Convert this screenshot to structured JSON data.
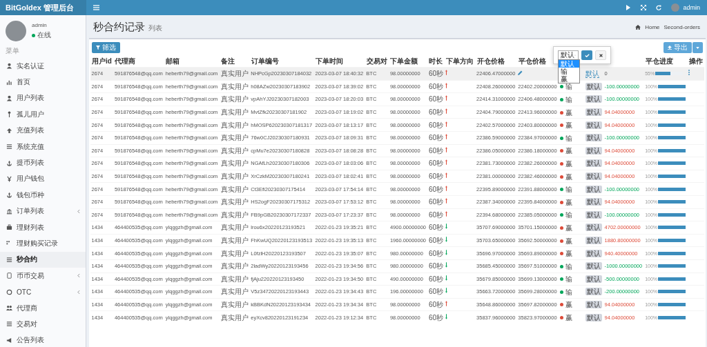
{
  "topbar": {
    "logo": "BitGoldex 管理后台",
    "user": "admin"
  },
  "sidebar": {
    "user": {
      "name": "admin",
      "status": "在线",
      "online": true
    },
    "menu_header": "菜单",
    "items": [
      {
        "label": "实名认证",
        "selected": false,
        "has_submenu": false
      },
      {
        "label": "首页",
        "selected": false,
        "has_submenu": false
      },
      {
        "label": "用户列表",
        "selected": false,
        "has_submenu": false
      },
      {
        "label": "孤儿用户",
        "selected": false,
        "has_submenu": false
      },
      {
        "label": "充值列表",
        "selected": false,
        "has_submenu": false
      },
      {
        "label": "系统充值",
        "selected": false,
        "has_submenu": false
      },
      {
        "label": "提币列表",
        "selected": false,
        "has_submenu": false
      },
      {
        "label": "用户钱包",
        "selected": false,
        "has_submenu": false
      },
      {
        "label": "钱包币种",
        "selected": false,
        "has_submenu": false
      },
      {
        "label": "订单列表",
        "selected": false,
        "has_submenu": true
      },
      {
        "label": "理财列表",
        "selected": false,
        "has_submenu": false
      },
      {
        "label": "理财购买记录",
        "selected": false,
        "has_submenu": false
      },
      {
        "label": "秒合约",
        "selected": true,
        "has_submenu": false
      },
      {
        "label": "币币交易",
        "selected": false,
        "has_submenu": true
      },
      {
        "label": "OTC",
        "selected": false,
        "has_submenu": true
      },
      {
        "label": "代理商",
        "selected": false,
        "has_submenu": false
      },
      {
        "label": "交易对",
        "selected": false,
        "has_submenu": false
      },
      {
        "label": "公告列表",
        "selected": false,
        "has_submenu": false
      }
    ]
  },
  "page": {
    "title": "秒合约记录",
    "subtitle": "列表",
    "breadcrumb": [
      "Home",
      "Second-orders"
    ]
  },
  "toolbar": {
    "filter_button": "筛选",
    "export_button": "导出"
  },
  "table": {
    "columns": [
      {
        "label": "用户id"
      },
      {
        "label": "代理商"
      },
      {
        "label": "邮箱"
      },
      {
        "label": "备注"
      },
      {
        "label": "订单编号"
      },
      {
        "label": "下单时间"
      },
      {
        "label": "交易对"
      },
      {
        "label": "下单金额"
      },
      {
        "label": "时长"
      },
      {
        "label": "下单方向"
      },
      {
        "label": "开仓价格"
      },
      {
        "label": "平仓价格"
      },
      {
        "kind": "result"
      },
      {},
      {},
      {
        "label": "平仓进度"
      },
      {
        "label": "操作"
      }
    ],
    "result_editor": {
      "options": [
        {
          "label": "默认",
          "selected": true
        },
        {
          "label": "输",
          "selected": false
        },
        {
          "label": "赢",
          "selected": false
        }
      ],
      "value": "默认"
    },
    "rows": [
      {
        "selected": true,
        "kind": "pending",
        "user_id": "2674",
        "agent": "591876548@qq.com",
        "email": "heberth79@gmail.com",
        "note": "真实用户",
        "order_no": "NHPcGp20230307184032",
        "time": "2023-03-07 18:40:32",
        "pair": "BTC",
        "amount": "98.00000000",
        "duration": "60秒",
        "rising": true,
        "open": "22406.47000000",
        "risk": "默认",
        "profit": "0",
        "progress": "55%",
        "level": 0.55
      },
      {
        "selected": false,
        "kind": "closed",
        "user_id": "2674",
        "agent": "591876548@qq.com",
        "email": "heberth79@gmail.com",
        "note": "真实用户",
        "order_no": "h08AZw20230307183902",
        "time": "2023-03-07 18:39:02",
        "pair": "BTC",
        "amount": "98.00000000",
        "duration": "60秒",
        "rising": true,
        "open": "22408.26000000",
        "close": "22402.20000000",
        "result": "输",
        "won": false,
        "risk": "默认",
        "profit": "-100.00000000",
        "progress": "100%",
        "level": 1
      },
      {
        "selected": false,
        "kind": "closed",
        "user_id": "2674",
        "agent": "591876548@qq.com",
        "email": "heberth79@gmail.com",
        "note": "真实用户",
        "order_no": "vpAhYJ20230307182003",
        "time": "2023-03-07 18:20:03",
        "pair": "BTC",
        "amount": "98.00000000",
        "duration": "60秒",
        "rising": true,
        "open": "22414.31000000",
        "close": "22406.48000000",
        "result": "输",
        "won": false,
        "risk": "默认",
        "profit": "-100.00000000",
        "progress": "100%",
        "level": 1
      },
      {
        "selected": false,
        "kind": "closed",
        "user_id": "2674",
        "agent": "591876548@qq.com",
        "email": "heberth79@gmail.com",
        "note": "真实用户",
        "order_no": "MvtZfk20230307181902",
        "time": "2023-03-07 18:19:02",
        "pair": "BTC",
        "amount": "98.00000000",
        "duration": "60秒",
        "rising": true,
        "open": "22404.79000000",
        "close": "22413.96000000",
        "result": "赢",
        "won": true,
        "risk": "默认",
        "profit": "94.04000000",
        "progress": "100%",
        "level": 1
      },
      {
        "selected": false,
        "kind": "closed",
        "user_id": "2674",
        "agent": "591876548@qq.com",
        "email": "heberth79@gmail.com",
        "note": "真实用户",
        "order_no": "hMOSP620230307181317",
        "time": "2023-03-07 18:13:17",
        "pair": "BTC",
        "amount": "98.00000000",
        "duration": "60秒",
        "rising": true,
        "open": "22402.57000000",
        "close": "22403.80000000",
        "result": "赢",
        "won": true,
        "risk": "默认",
        "profit": "94.04000000",
        "progress": "100%",
        "level": 1
      },
      {
        "selected": false,
        "kind": "closed",
        "user_id": "2674",
        "agent": "591876548@qq.com",
        "email": "heberth79@gmail.com",
        "note": "真实用户",
        "order_no": "76w0CJ20230307180931",
        "time": "2023-03-07 18:09:31",
        "pair": "BTC",
        "amount": "98.00000000",
        "duration": "60秒",
        "rising": true,
        "open": "22386.59000000",
        "close": "22384.97000000",
        "result": "输",
        "won": false,
        "risk": "默认",
        "profit": "-100.00000000",
        "progress": "100%",
        "level": 1
      },
      {
        "selected": false,
        "kind": "closed",
        "user_id": "2674",
        "agent": "591876548@qq.com",
        "email": "heberth79@gmail.com",
        "note": "真实用户",
        "order_no": "cpMu7e20230307180828",
        "time": "2023-03-07 18:08:28",
        "pair": "BTC",
        "amount": "98.00000000",
        "duration": "60秒",
        "rising": true,
        "open": "22386.05000000",
        "close": "22386.18000000",
        "result": "赢",
        "won": true,
        "risk": "默认",
        "profit": "94.04000000",
        "progress": "100%",
        "level": 1
      },
      {
        "selected": false,
        "kind": "closed",
        "user_id": "2674",
        "agent": "591876548@qq.com",
        "email": "heberth79@gmail.com",
        "note": "真实用户",
        "order_no": "NGAfLh20230307180306",
        "time": "2023-03-07 18:03:06",
        "pair": "BTC",
        "amount": "98.00000000",
        "duration": "60秒",
        "rising": true,
        "open": "22381.73000000",
        "close": "22382.26000000",
        "result": "赢",
        "won": true,
        "risk": "默认",
        "profit": "94.04000000",
        "progress": "100%",
        "level": 1
      },
      {
        "selected": false,
        "kind": "closed",
        "user_id": "2674",
        "agent": "591876548@qq.com",
        "email": "heberth79@gmail.com",
        "note": "真实用户",
        "order_no": "XrCzkM20230307180241",
        "time": "2023-03-07 18:02:41",
        "pair": "BTC",
        "amount": "98.00000000",
        "duration": "60秒",
        "rising": true,
        "open": "22381.00000000",
        "close": "22382.46000000",
        "result": "赢",
        "won": true,
        "risk": "默认",
        "profit": "94.04000000",
        "progress": "100%",
        "level": 1
      },
      {
        "selected": false,
        "kind": "closed",
        "user_id": "2674",
        "agent": "591876548@qq.com",
        "email": "heberth79@gmail.com",
        "note": "真实用户",
        "order_no": "Ct3Efi20230307175414",
        "time": "2023-03-07 17:54:14",
        "pair": "BTC",
        "amount": "98.00000000",
        "duration": "60秒",
        "rising": true,
        "open": "22395.89000000",
        "close": "22391.88000000",
        "result": "输",
        "won": false,
        "risk": "默认",
        "profit": "-100.00000000",
        "progress": "100%",
        "level": 1
      },
      {
        "selected": false,
        "kind": "closed",
        "user_id": "2674",
        "agent": "591876548@qq.com",
        "email": "heberth79@gmail.com",
        "note": "真实用户",
        "order_no": "HS2ogF20230307175312",
        "time": "2023-03-07 17:53:12",
        "pair": "BTC",
        "amount": "98.00000000",
        "duration": "60秒",
        "rising": true,
        "open": "22387.34000000",
        "close": "22395.84000000",
        "result": "赢",
        "won": true,
        "risk": "默认",
        "profit": "94.04000000",
        "progress": "100%",
        "level": 1
      },
      {
        "selected": false,
        "kind": "closed",
        "user_id": "2674",
        "agent": "591876548@qq.com",
        "email": "heberth79@gmail.com",
        "note": "真实用户",
        "order_no": "FB9pGB20230307172337",
        "time": "2023-03-07 17:23:37",
        "pair": "BTC",
        "amount": "98.00000000",
        "duration": "60秒",
        "rising": true,
        "open": "22394.68000000",
        "close": "22385.05000000",
        "result": "输",
        "won": false,
        "risk": "默认",
        "profit": "-100.00000000",
        "progress": "100%",
        "level": 1
      },
      {
        "selected": false,
        "kind": "closed",
        "user_id": "1434",
        "agent": "464400535@qq.com",
        "email": "ylqggzh@gmail.com",
        "note": "真实用户",
        "order_no": "lrou6x20220123193521",
        "time": "2022-01-23 19:35:21",
        "pair": "BTC",
        "amount": "4900.00000000",
        "duration": "60秒",
        "rising": false,
        "open": "35707.69000000",
        "close": "35701.15000000",
        "result": "赢",
        "won": true,
        "risk": "默认",
        "profit": "4702.00000000",
        "progress": "100%",
        "level": 1
      },
      {
        "selected": false,
        "kind": "closed",
        "user_id": "1434",
        "agent": "464400535@qq.com",
        "email": "ylqggzh@gmail.com",
        "note": "真实用户",
        "order_no": "FhKwUQ20220123193513",
        "time": "2022-01-23 19:35:13",
        "pair": "BTC",
        "amount": "1960.00000000",
        "duration": "60秒",
        "rising": false,
        "open": "35703.65000000",
        "close": "35692.50000000",
        "result": "赢",
        "won": true,
        "risk": "默认",
        "profit": "1880.80000000",
        "progress": "100%",
        "level": 1
      },
      {
        "selected": false,
        "kind": "closed",
        "user_id": "1434",
        "agent": "464400535@qq.com",
        "email": "ylqggzh@gmail.com",
        "note": "真实用户",
        "order_no": "L0fzlH20220123193507",
        "time": "2022-01-23 19:35:07",
        "pair": "BTC",
        "amount": "980.00000000",
        "duration": "60秒",
        "rising": false,
        "open": "35696.97000000",
        "close": "35693.89000000",
        "result": "赢",
        "won": true,
        "risk": "默认",
        "profit": "940.40000000",
        "progress": "100%",
        "level": 1
      },
      {
        "selected": false,
        "kind": "closed",
        "user_id": "1434",
        "agent": "464400535@qq.com",
        "email": "ylqggzh@gmail.com",
        "note": "真实用户",
        "order_no": "2ladWy20220123193456",
        "time": "2022-01-23 19:34:56",
        "pair": "BTC",
        "amount": "980.00000000",
        "duration": "60秒",
        "rising": false,
        "open": "35685.45000000",
        "close": "35697.51000000",
        "result": "输",
        "won": false,
        "risk": "默认",
        "profit": "-1000.00000000",
        "progress": "100%",
        "level": 1
      },
      {
        "selected": false,
        "kind": "closed",
        "user_id": "1434",
        "agent": "464400535@qq.com",
        "email": "ylqggzh@gmail.com",
        "note": "真实用户",
        "order_no": "fjAju220220123193450",
        "time": "2022-01-23 19:34:50",
        "pair": "BTC",
        "amount": "490.00000000",
        "duration": "60秒",
        "rising": false,
        "open": "35679.85000000",
        "close": "35699.13000000",
        "result": "输",
        "won": false,
        "risk": "默认",
        "profit": "-500.00000000",
        "progress": "100%",
        "level": 1
      },
      {
        "selected": false,
        "kind": "closed",
        "user_id": "1434",
        "agent": "464400535@qq.com",
        "email": "ylqggzh@gmail.com",
        "note": "真实用户",
        "order_no": "V5z34720220123193443",
        "time": "2022-01-23 19:34:43",
        "pair": "BTC",
        "amount": "196.00000000",
        "duration": "60秒",
        "rising": false,
        "open": "35663.72000000",
        "close": "35699.28000000",
        "result": "输",
        "won": false,
        "risk": "默认",
        "profit": "-200.00000000",
        "progress": "100%",
        "level": 1
      },
      {
        "selected": false,
        "kind": "closed",
        "user_id": "1434",
        "agent": "464400535@qq.com",
        "email": "ylqggzh@gmail.com",
        "note": "真实用户",
        "order_no": "kBBKdN20220123193434",
        "time": "2022-01-23 19:34:34",
        "pair": "BTC",
        "amount": "98.00000000",
        "duration": "60秒",
        "rising": true,
        "open": "35648.86000000",
        "close": "35697.82000000",
        "result": "赢",
        "won": true,
        "risk": "默认",
        "profit": "94.04000000",
        "progress": "100%",
        "level": 1
      },
      {
        "selected": false,
        "kind": "closed",
        "user_id": "1434",
        "agent": "464400535@qq.com",
        "email": "ylqggzh@gmail.com",
        "note": "真实用户",
        "order_no": "eyXcv820220123191234",
        "time": "2022-01-23 19:12:34",
        "pair": "BTC",
        "amount": "98.00000000",
        "duration": "60秒",
        "rising": false,
        "open": "35837.96000000",
        "close": "35823.97000000",
        "result": "赢",
        "won": true,
        "risk": "默认",
        "profit": "94.04000000",
        "progress": "100%",
        "level": 1
      }
    ]
  }
}
